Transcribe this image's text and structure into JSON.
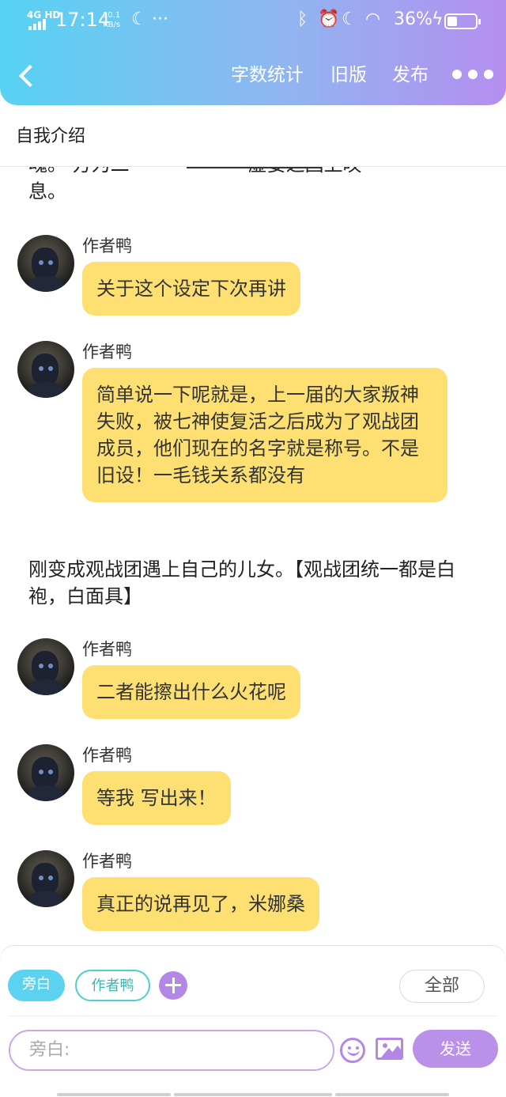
{
  "status_bar": {
    "network": "4G HD",
    "time": "17:14",
    "speed_value": "10.1",
    "speed_unit": "KB/s",
    "dots": "···",
    "battery_pct": "36%",
    "battery_level": 0.36
  },
  "nav": {
    "word_count": "字数统计",
    "old_version": "旧版",
    "publish": "发布"
  },
  "section_title": "自我介绍",
  "chat": {
    "top_fragment_line1": "魂。  方为二",
    "top_fragment_line1_end": "虚妄之国上叹",
    "top_fragment_line2": "息。",
    "messages": [
      {
        "sender": "作者鸭",
        "text": "关于这个设定下次再讲"
      },
      {
        "sender": "作者鸭",
        "text": "简单说一下呢就是，上一届的大家叛神失败，被七神使复活之后成为了观战团成员，他们现在的名字就是称号。不是旧设！一毛钱关系都没有"
      },
      {
        "sender": "作者鸭",
        "text": "二者能擦出什么火花呢"
      },
      {
        "sender": "作者鸭",
        "text": "等我 写出来！"
      },
      {
        "sender": "作者鸭",
        "text": "真正的说再见了，米娜桑"
      }
    ],
    "narration": "刚变成观战团遇上自己的儿女。【观战团统一都是白袍，白面具】"
  },
  "composer": {
    "chip_narrator": "旁白",
    "chip_author": "作者鸭",
    "all": "全部",
    "input_placeholder": "旁白:",
    "send": "发送"
  },
  "colors": {
    "bubble": "#fde071",
    "accent_purple": "#b487e6",
    "accent_cyan": "#5bd3f0"
  }
}
